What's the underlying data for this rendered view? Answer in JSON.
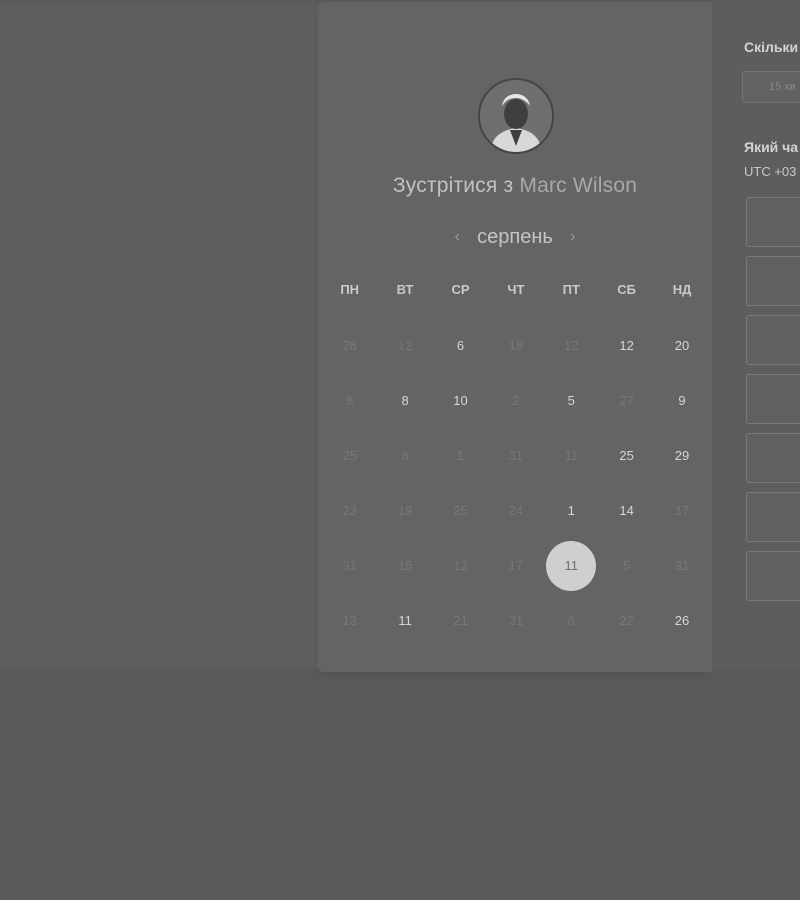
{
  "booking": {
    "title_prefix": "Зустрітися з",
    "host_name": "Marc Wilson",
    "month": "серпень",
    "prev_icon": "‹",
    "next_icon": "›"
  },
  "weekdays": [
    "ПН",
    "ВТ",
    "СР",
    "ЧТ",
    "ПТ",
    "СБ",
    "НД"
  ],
  "days": [
    {
      "label": "28",
      "available": false
    },
    {
      "label": "12",
      "available": false
    },
    {
      "label": "6",
      "available": true
    },
    {
      "label": "18",
      "available": false
    },
    {
      "label": "12",
      "available": false
    },
    {
      "label": "12",
      "available": true
    },
    {
      "label": "20",
      "available": true
    },
    {
      "label": "8",
      "available": false
    },
    {
      "label": "8",
      "available": true
    },
    {
      "label": "10",
      "available": true
    },
    {
      "label": "2",
      "available": false
    },
    {
      "label": "5",
      "available": true
    },
    {
      "label": "27",
      "available": false
    },
    {
      "label": "9",
      "available": true
    },
    {
      "label": "25",
      "available": false
    },
    {
      "label": "8",
      "available": false
    },
    {
      "label": "1",
      "available": false
    },
    {
      "label": "31",
      "available": false
    },
    {
      "label": "11",
      "available": false
    },
    {
      "label": "25",
      "available": true
    },
    {
      "label": "29",
      "available": true
    },
    {
      "label": "23",
      "available": false
    },
    {
      "label": "19",
      "available": false
    },
    {
      "label": "25",
      "available": false
    },
    {
      "label": "24",
      "available": false
    },
    {
      "label": "1",
      "available": true
    },
    {
      "label": "14",
      "available": true
    },
    {
      "label": "17",
      "available": false
    },
    {
      "label": "31",
      "available": false
    },
    {
      "label": "15",
      "available": false
    },
    {
      "label": "12",
      "available": false
    },
    {
      "label": "17",
      "available": false
    },
    {
      "label": "11",
      "available": true,
      "selected": true
    },
    {
      "label": "5",
      "available": false
    },
    {
      "label": "31",
      "available": false
    },
    {
      "label": "13",
      "available": false
    },
    {
      "label": "11",
      "available": true
    },
    {
      "label": "21",
      "available": false
    },
    {
      "label": "31",
      "available": false
    },
    {
      "label": "8",
      "available": false
    },
    {
      "label": "22",
      "available": false
    },
    {
      "label": "26",
      "available": true
    }
  ],
  "right_panel": {
    "duration_label": "Скільки",
    "duration_value": "15 хв",
    "time_label": "Який ча",
    "timezone": "UTC +03",
    "time_slots": [
      "",
      "",
      "",
      "",
      "",
      "",
      ""
    ]
  },
  "colors": {
    "selected_day": "#cfcfcf",
    "available_day": "#d6d6d6",
    "unavailable_day": "#777777"
  }
}
